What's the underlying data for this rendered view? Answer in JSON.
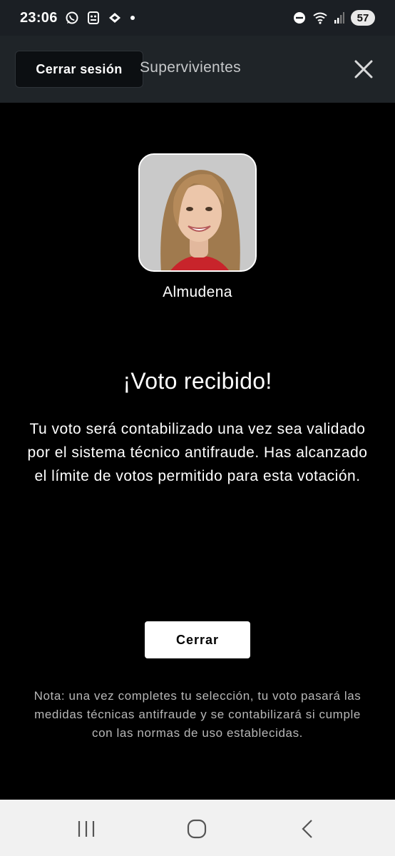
{
  "status_bar": {
    "time": "23:06",
    "battery_level": "57",
    "icons": [
      "whatsapp-icon",
      "app-icon",
      "app-icon-2",
      "dot-icon",
      "dnd-icon",
      "wifi-icon",
      "signal-icon"
    ]
  },
  "app_bar": {
    "logout_label": "Cerrar sesión",
    "title": "Supervivientes",
    "close_icon": "close-icon"
  },
  "candidate": {
    "name": "Almudena"
  },
  "confirmation": {
    "headline": "¡Voto recibido!",
    "message": "Tu voto será contabilizado una vez sea validado por el sistema técnico antifraude. Has alcanzado el límite de votos permitido para esta votación.",
    "close_label": "Cerrar",
    "note": "Nota: una vez completes tu selección, tu voto pasará las medidas técnicas antifraude y se contabilizará si cumple con las normas de uso establecidas."
  },
  "nav_bar": {
    "items": [
      "recents-icon",
      "home-icon",
      "back-icon"
    ]
  },
  "colors": {
    "background": "#000000",
    "app_bar": "#1f2428",
    "status_bar": "#1b1f24",
    "note_text": "#b7b7b7",
    "nav_bar": "#f1f1f1"
  }
}
